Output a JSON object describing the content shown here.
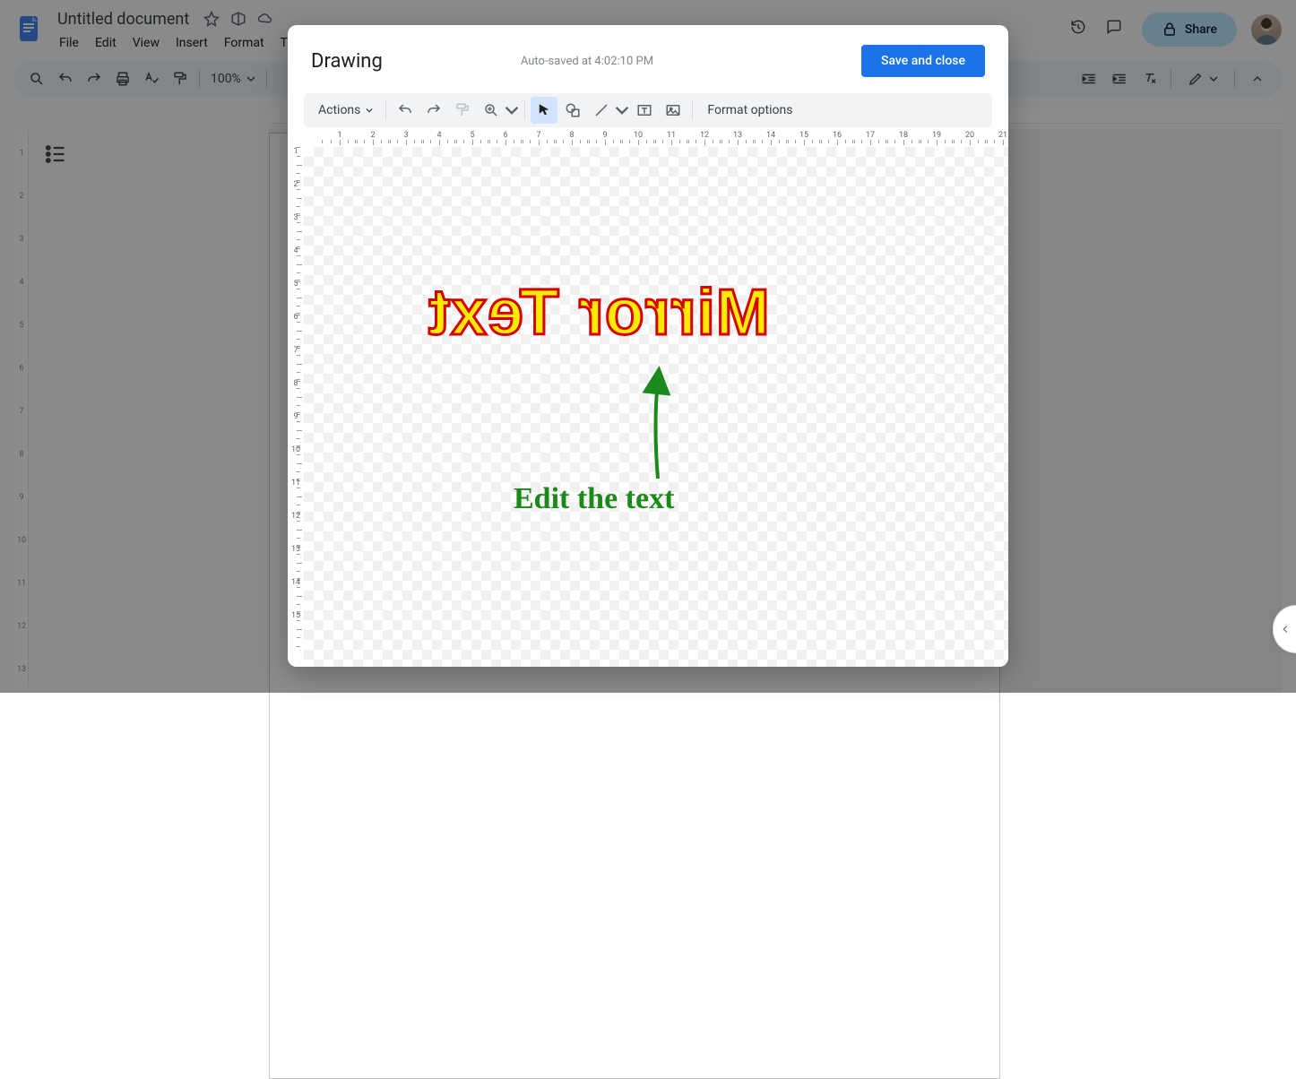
{
  "app": {
    "doc_title": "Untitled document",
    "menus": [
      "File",
      "Edit",
      "View",
      "Insert",
      "Format",
      "Tools"
    ],
    "share_label": "Share",
    "zoom": "100%"
  },
  "toolbar_right_icons": [
    "history-icon",
    "comment-icon"
  ],
  "modal": {
    "title": "Drawing",
    "autosave": "Auto-saved at 4:02:10 PM",
    "save_label": "Save and close",
    "actions_label": "Actions",
    "format_options_label": "Format options"
  },
  "drawing_toolbar": {
    "buttons": [
      {
        "name": "undo",
        "icon": "undo",
        "disabled": false
      },
      {
        "name": "redo",
        "icon": "redo",
        "disabled": false
      },
      {
        "name": "paint-format",
        "icon": "paint-roller",
        "disabled": true
      },
      {
        "name": "zoom",
        "icon": "zoom",
        "dropdown": true
      },
      {
        "name": "select",
        "icon": "cursor",
        "active": true
      },
      {
        "name": "shape",
        "icon": "shape",
        "dropdown": false
      },
      {
        "name": "line",
        "icon": "line",
        "dropdown": true
      },
      {
        "name": "text-box",
        "icon": "textbox"
      },
      {
        "name": "image",
        "icon": "image"
      }
    ]
  },
  "ruler": {
    "h": [
      "1",
      "2",
      "3",
      "4",
      "5",
      "6",
      "7",
      "8",
      "9",
      "10",
      "11",
      "12",
      "13",
      "14",
      "15",
      "16",
      "17",
      "18",
      "19",
      "20",
      "21"
    ],
    "v": [
      "1",
      "2",
      "3",
      "4",
      "5",
      "6",
      "7",
      "8",
      "9",
      "10",
      "11",
      "12",
      "13",
      "14",
      "15"
    ],
    "doc_v": [
      "1",
      "2",
      "3",
      "4",
      "5",
      "6",
      "7",
      "8",
      "9",
      "10",
      "11",
      "12",
      "13"
    ]
  },
  "canvas": {
    "mirror_text": "Mirror Text",
    "annotation_text": "Edit the text"
  }
}
